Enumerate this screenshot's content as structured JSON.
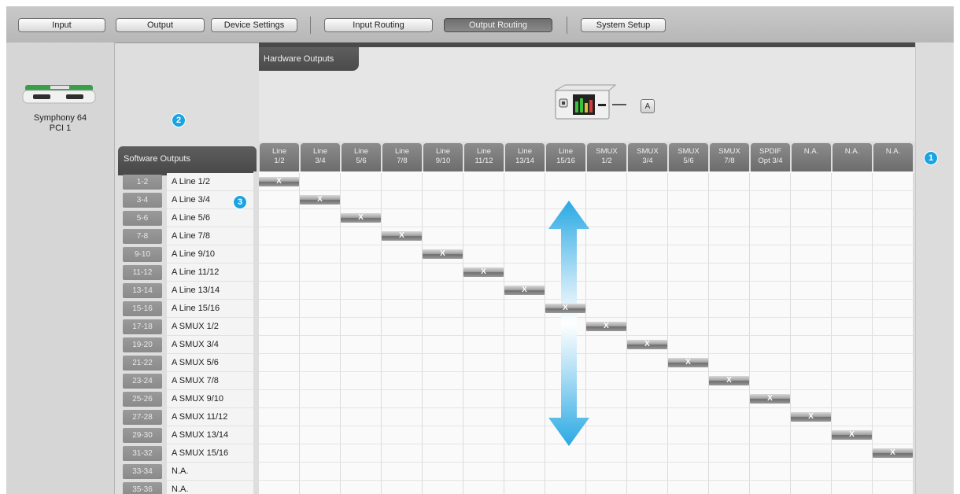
{
  "toolbar": {
    "buttons": [
      {
        "label": "Input",
        "active": false
      },
      {
        "label": "Output",
        "active": false
      },
      {
        "label": "Device Settings",
        "active": false
      },
      {
        "label": "Input Routing",
        "active": false
      },
      {
        "label": "Output Routing",
        "active": true
      },
      {
        "label": "System Setup",
        "active": false
      }
    ]
  },
  "device": {
    "name_line1": "Symphony 64",
    "name_line2": "PCI 1"
  },
  "badges": [
    "1",
    "2",
    "3"
  ],
  "software_outputs": {
    "title": "Software Outputs",
    "rows": [
      {
        "range": "1-2",
        "label": "A Line 1/2"
      },
      {
        "range": "3-4",
        "label": "A Line 3/4"
      },
      {
        "range": "5-6",
        "label": "A Line 5/6"
      },
      {
        "range": "7-8",
        "label": "A Line 7/8"
      },
      {
        "range": "9-10",
        "label": "A Line 9/10"
      },
      {
        "range": "11-12",
        "label": "A Line 11/12"
      },
      {
        "range": "13-14",
        "label": "A Line 13/14"
      },
      {
        "range": "15-16",
        "label": "A Line 15/16"
      },
      {
        "range": "17-18",
        "label": "A SMUX 1/2"
      },
      {
        "range": "19-20",
        "label": "A SMUX 3/4"
      },
      {
        "range": "21-22",
        "label": "A SMUX 5/6"
      },
      {
        "range": "23-24",
        "label": "A SMUX 7/8"
      },
      {
        "range": "25-26",
        "label": "A SMUX 9/10"
      },
      {
        "range": "27-28",
        "label": "A SMUX 11/12"
      },
      {
        "range": "29-30",
        "label": "A SMUX 13/14"
      },
      {
        "range": "31-32",
        "label": "A SMUX 15/16"
      },
      {
        "range": "33-34",
        "label": "N.A."
      },
      {
        "range": "35-36",
        "label": "N.A."
      }
    ]
  },
  "hardware_outputs": {
    "title": "Hardware Outputs",
    "device_letter": "A",
    "columns": [
      {
        "l1": "Line",
        "l2": "1/2"
      },
      {
        "l1": "Line",
        "l2": "3/4"
      },
      {
        "l1": "Line",
        "l2": "5/6"
      },
      {
        "l1": "Line",
        "l2": "7/8"
      },
      {
        "l1": "Line",
        "l2": "9/10"
      },
      {
        "l1": "Line",
        "l2": "11/12"
      },
      {
        "l1": "Line",
        "l2": "13/14"
      },
      {
        "l1": "Line",
        "l2": "15/16"
      },
      {
        "l1": "SMUX",
        "l2": "1/2"
      },
      {
        "l1": "SMUX",
        "l2": "3/4"
      },
      {
        "l1": "SMUX",
        "l2": "5/6"
      },
      {
        "l1": "SMUX",
        "l2": "7/8"
      },
      {
        "l1": "SPDIF",
        "l2": "Opt 3/4"
      },
      {
        "l1": "N.A.",
        "l2": ""
      },
      {
        "l1": "N.A.",
        "l2": ""
      },
      {
        "l1": "N.A.",
        "l2": ""
      }
    ]
  },
  "routing": {
    "mark": "X",
    "connections": [
      [
        0,
        0
      ],
      [
        1,
        1
      ],
      [
        2,
        2
      ],
      [
        3,
        3
      ],
      [
        4,
        4
      ],
      [
        5,
        5
      ],
      [
        6,
        6
      ],
      [
        7,
        7
      ],
      [
        8,
        8
      ],
      [
        9,
        9
      ],
      [
        10,
        10
      ],
      [
        11,
        11
      ],
      [
        12,
        12
      ],
      [
        13,
        13
      ],
      [
        14,
        14
      ],
      [
        15,
        15
      ]
    ]
  },
  "colors": {
    "accent_badge": "#1aa3e0",
    "arrow": "#29a9e3",
    "header_dark": "#4a4a4a"
  }
}
